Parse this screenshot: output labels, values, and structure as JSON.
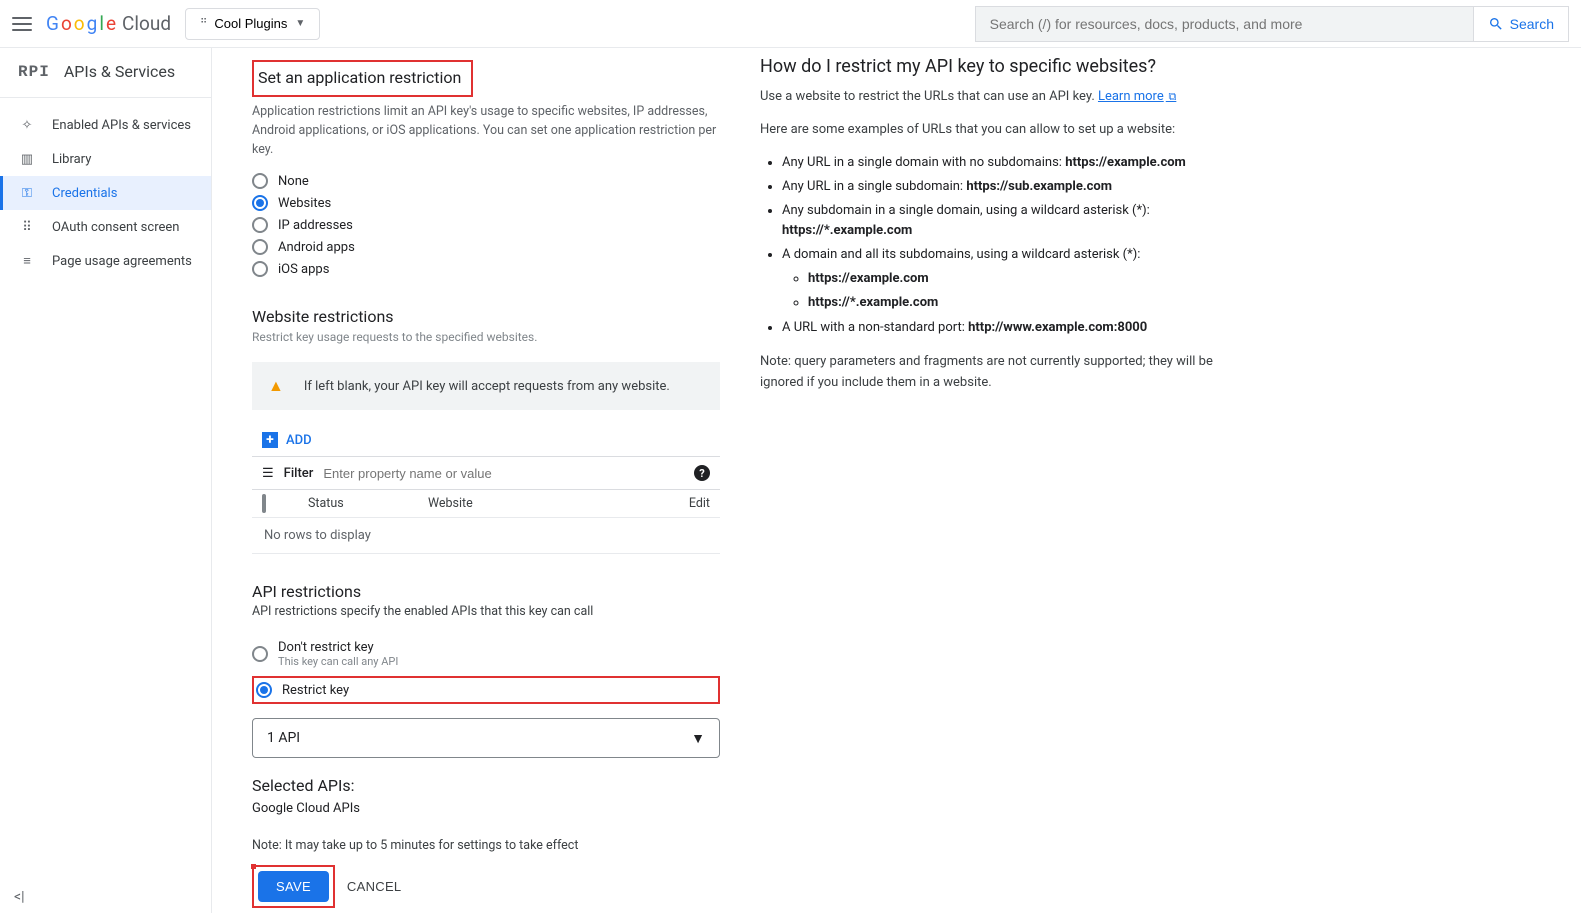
{
  "header": {
    "logo_suffix": "Cloud",
    "project": "Cool Plugins",
    "search_placeholder": "Search (/) for resources, docs, products, and more",
    "search_button": "Search"
  },
  "sidenav": {
    "title": "APIs & Services",
    "items": [
      {
        "icon": "✧",
        "label": "Enabled APIs & services"
      },
      {
        "icon": "▥",
        "label": "Library"
      },
      {
        "icon": "⊶",
        "label": "Credentials",
        "active": true
      },
      {
        "icon": "⋯",
        "label": "OAuth consent screen"
      },
      {
        "icon": "≡₀",
        "label": "Page usage agreements"
      }
    ]
  },
  "app_restriction": {
    "title": "Set an application restriction",
    "desc": "Application restrictions limit an API key's usage to specific websites, IP addresses, Android applications, or iOS applications. You can set one application restriction per key.",
    "options": [
      "None",
      "Websites",
      "IP addresses",
      "Android apps",
      "iOS apps"
    ],
    "selected": "Websites"
  },
  "website_restrictions": {
    "title": "Website restrictions",
    "desc": "Restrict key usage requests to the specified websites.",
    "warning": "If left blank, your API key will accept requests from any website.",
    "add": "ADD",
    "filter_label": "Filter",
    "filter_placeholder": "Enter property name or value",
    "cols": {
      "status": "Status",
      "website": "Website",
      "edit": "Edit"
    },
    "empty": "No rows to display"
  },
  "api_restrictions": {
    "title": "API restrictions",
    "desc": "API restrictions specify the enabled APIs that this key can call",
    "opt_dont": "Don't restrict key",
    "opt_dont_hint": "This key can call any API",
    "opt_restrict": "Restrict key",
    "select_value": "1 API",
    "selected_title": "Selected APIs:",
    "selected_api": "Google Cloud APIs"
  },
  "note": "Note: It may take up to 5 minutes for settings to take effect",
  "buttons": {
    "save": "SAVE",
    "cancel": "CANCEL"
  },
  "help": {
    "title": "How do I restrict my API key to specific websites?",
    "p1a": "Use a website to restrict the URLs that can use an API key. ",
    "p1b": "Learn more",
    "p2": "Here are some examples of URLs that you can allow to set up a website:",
    "li1a": "Any URL in a single domain with no subdomains: ",
    "li1b": "https://example.com",
    "li2a": "Any URL in a single subdomain: ",
    "li2b": "https://sub.example.com",
    "li3a": "Any subdomain in a single domain, using a wildcard asterisk (*): ",
    "li3b": "https://*.example.com",
    "li4": "A domain and all its subdomains, using a wildcard asterisk (*):",
    "li4s1": "https://example.com",
    "li4s2": "https://*.example.com",
    "li5a": "A URL with a non-standard port: ",
    "li5b": "http://www.example.com:8000",
    "note": "Note: query parameters and fragments are not currently supported; they will be ignored if you include them in a website."
  }
}
